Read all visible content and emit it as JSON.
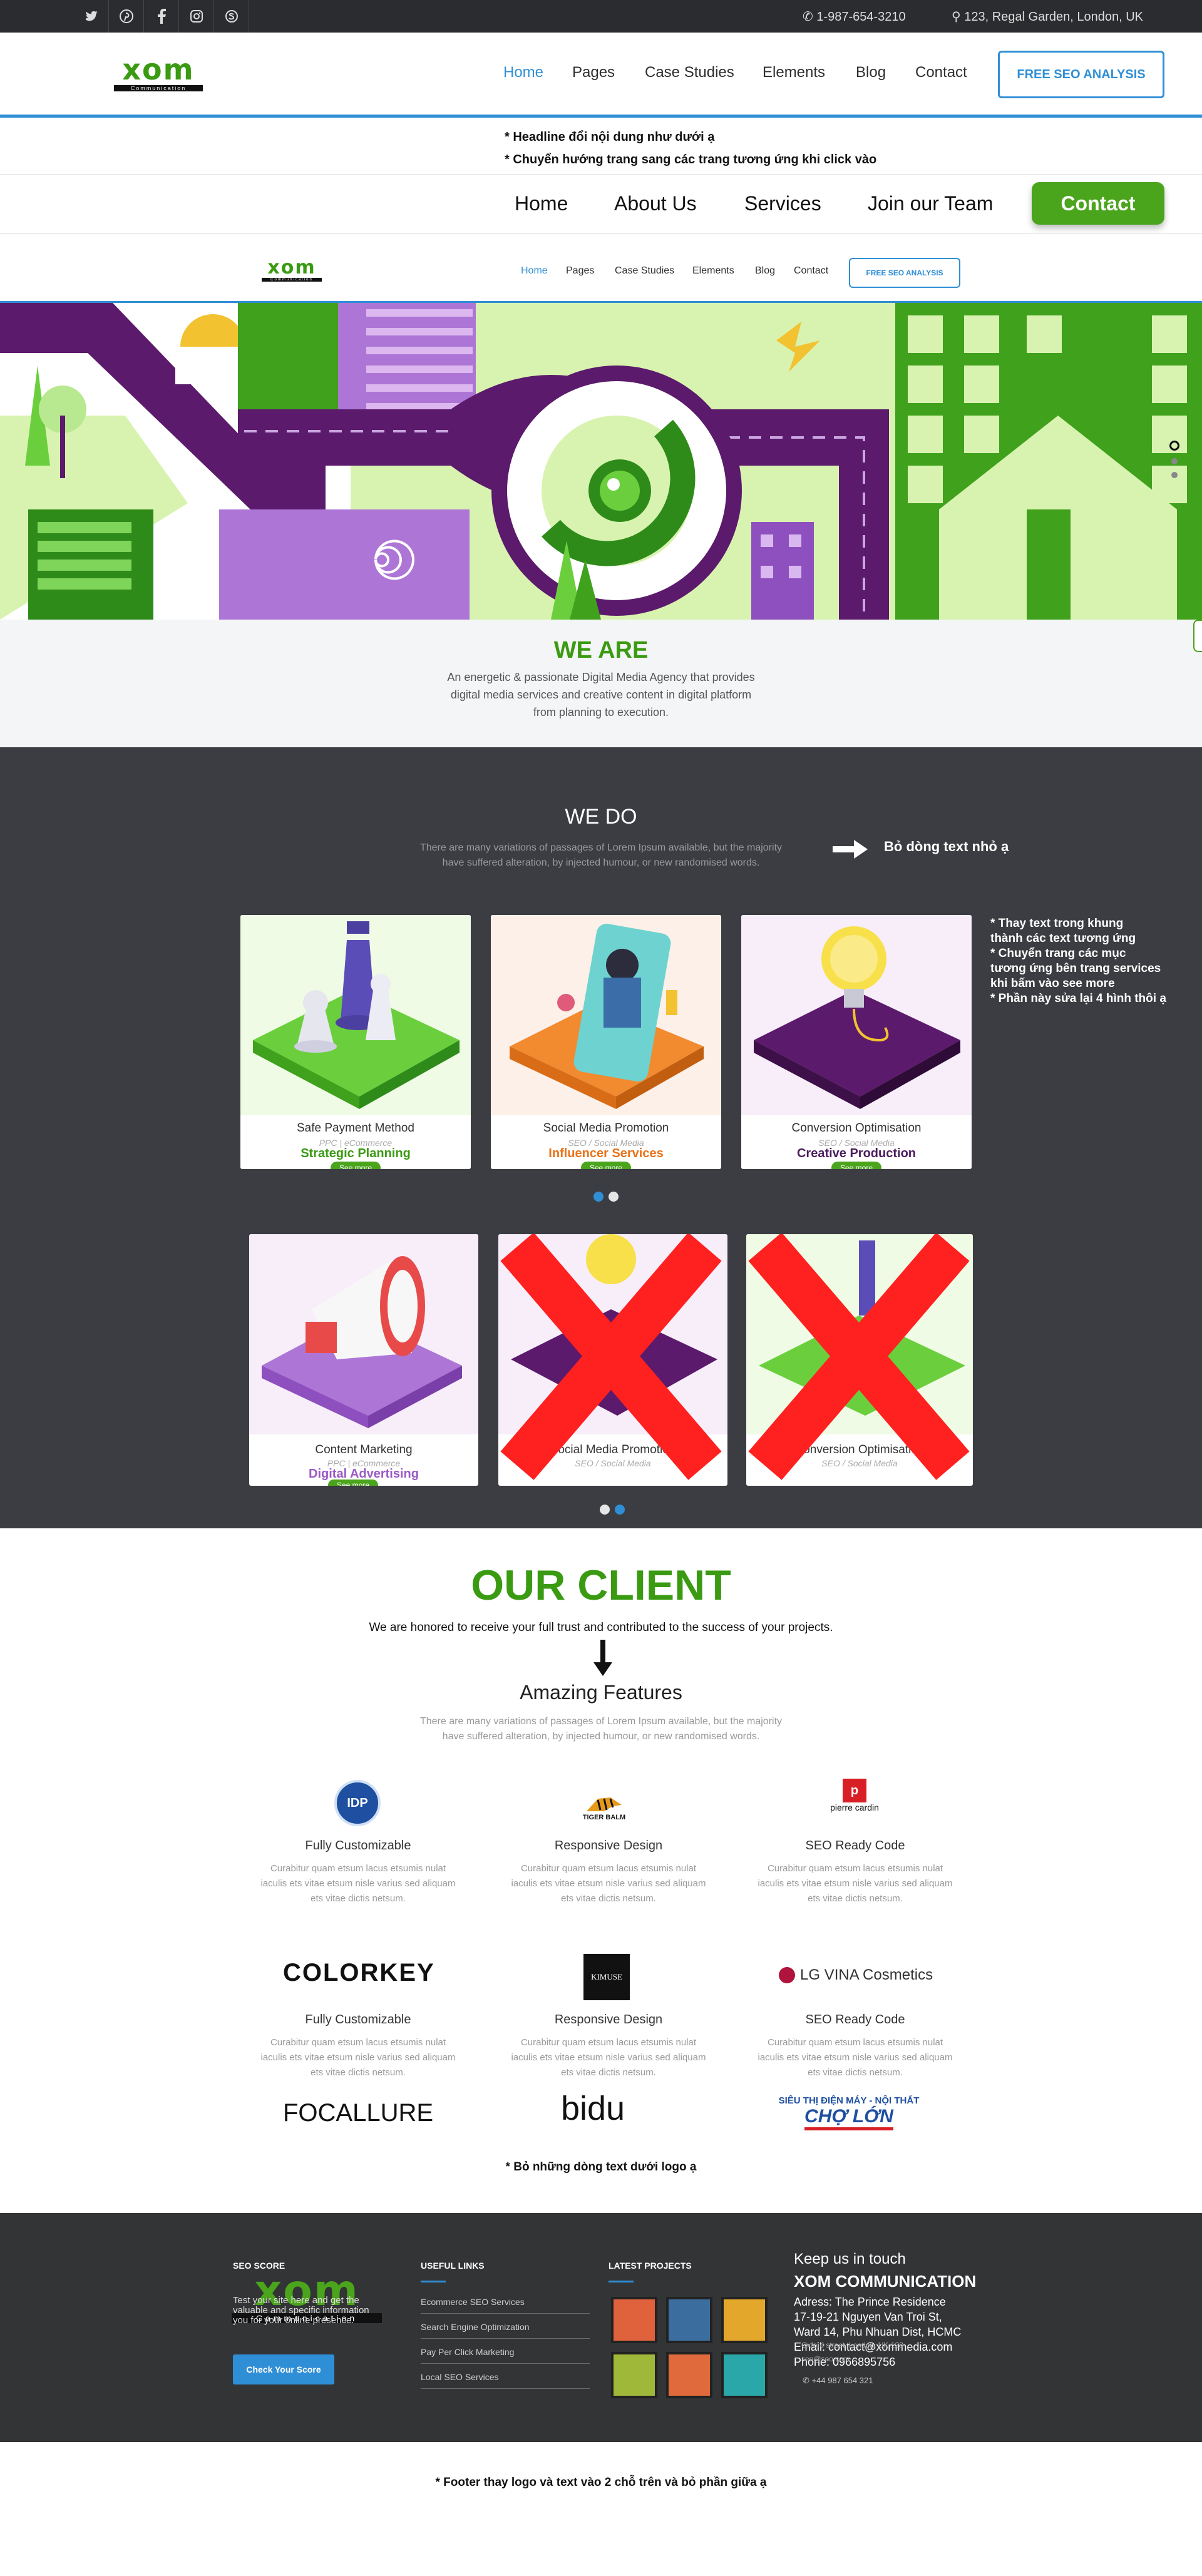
{
  "topbar": {
    "phone": "1-987-654-3210",
    "address": "123, Regal Garden, London, UK"
  },
  "logo": {
    "main": "xom",
    "sub": "Communication"
  },
  "nav1": {
    "items": [
      "Home",
      "Pages",
      "Case Studies",
      "Elements",
      "Blog",
      "Contact"
    ],
    "cta": "FREE SEO ANALYSIS"
  },
  "notes": {
    "headline1": "* Headline đổi nội dung như dưới ạ",
    "headline2": "* Chuyển hướng trang sang các trang tương ứng khi click vào",
    "wedo_arrow": "Bỏ dòng text nhỏ ạ",
    "cards": [
      "* Thay text trong khung",
      "thành các text tương ứng",
      "* Chuyển trang các mục",
      "tương ứng bên trang services",
      "khi bấm vào see more",
      "* Phần này sửa lại 4 hình thôi ạ"
    ],
    "logos": "* Bỏ những dòng text dưới logo ạ",
    "footer": "* Footer thay logo và text vào 2 chỗ trên và bỏ phần giữa ạ"
  },
  "nav2": {
    "items": [
      "Home",
      "About Us",
      "Services",
      "Join our Team"
    ],
    "cta": "Contact"
  },
  "nav3": {
    "items": [
      "Home",
      "Pages",
      "Case Studies",
      "Elements",
      "Blog",
      "Contact"
    ],
    "cta": "FREE SEO ANALYSIS"
  },
  "weare": {
    "title": "WE ARE",
    "lines": [
      "An energetic & passionate Digital Media Agency that provides",
      "digital media services and creative content in digital platform",
      "from planning to execution."
    ]
  },
  "wedo": {
    "title": "WE DO",
    "lines": [
      "There are many variations of passages of Lorem Ipsum available, but the majority",
      "have suffered alteration, by injected humour, or new randomised words."
    ],
    "cards_row1": [
      {
        "title": "Safe Payment Method",
        "sub": "PPC | eCommerce",
        "tag": "Strategic Planning",
        "tag_color": "#3a9b12",
        "see": "See more"
      },
      {
        "title": "Social Media Promotion",
        "sub": "SEO / Social Media",
        "tag": "Influencer Services",
        "tag_color": "#e8731a",
        "see": "See more"
      },
      {
        "title": "Conversion Optimisation",
        "sub": "SEO / Social Media",
        "tag": "Creative Production",
        "tag_color": "#4b1d5e",
        "see": "See more"
      }
    ],
    "cards_row2": [
      {
        "title": "Content Marketing",
        "sub": "PPC | eCommerce",
        "tag": "Digital Advertising",
        "tag_color": "#9b59c6",
        "see": "See more"
      },
      {
        "title": "Social Media Promotion",
        "sub": "SEO / Social Media"
      },
      {
        "title": "Conversion Optimisation",
        "sub": "SEO / Social Media"
      }
    ]
  },
  "client": {
    "title": "OUR CLIENT",
    "subtitle": "We are honored to receive your full trust and contributed to the success of your projects.",
    "features_title": "Amazing Features",
    "features_lines": [
      "There are many variations of passages of Lorem Ipsum available, but the majority",
      "have suffered alteration, by injected humour, or new randomised words."
    ],
    "row1": [
      {
        "logo": "IDP",
        "title": "Fully Customizable"
      },
      {
        "logo": "TIGER BALM",
        "title": "Responsive Design"
      },
      {
        "logo": "pierre cardin",
        "title": "SEO Ready Code"
      }
    ],
    "row2": [
      {
        "logo": "COLORKEY",
        "title": "Fully Customizable"
      },
      {
        "logo": "KIMUSE",
        "title": "Responsive Design"
      },
      {
        "logo": "LG VINA Cosmetics",
        "title": "SEO Ready Code"
      }
    ],
    "row3": [
      "FOCALLURE",
      "bidu",
      "SIÊU THỊ ĐIỆN MÁY - NỘI THẤT",
      "CHỢ LỚN"
    ],
    "desc": [
      "Curabitur quam etsum lacus etsumis nulat",
      "iaculis ets vitae etsum nisle varius sed aliquam",
      "ets vitae dictis netsum."
    ]
  },
  "footer": {
    "col1_title": "SEO SCORE",
    "col1_text": [
      "Test your site here and get the",
      "valuable and specific information",
      "you for your online presence."
    ],
    "col1_button": "Check Your Score",
    "col2_title": "USEFUL LINKS",
    "links": [
      "Ecommerce SEO Services",
      "Search Engine Optimization",
      "Pay Per Click Marketing",
      "Local SEO Services"
    ],
    "col3_title": "LATEST PROJECTS",
    "projects": [
      "#e0623d",
      "#3b6e9e",
      "#e3a82b",
      "#a0b83a",
      "#e06a3b",
      "#2aa7a8"
    ],
    "col4_title": "Keep us in touch",
    "company": "XOM COMMUNICATION",
    "col4_lines": [
      "Adress: The Prince Residence",
      "17-19-21 Nguyen Van Troi St,",
      "Ward 14, Phu Nhuan Dist, HCMC",
      "Email: contact@xommedia.com",
      "Phone: 0966895756"
    ],
    "old_address": "Oxford street, London, UK 123",
    "old_email": "seo@seo.com",
    "old_phone": "+44 987 654 321"
  },
  "colors": {
    "green": "#4aa41c",
    "blue": "#2f8fd6",
    "dark": "#3b3d42"
  }
}
